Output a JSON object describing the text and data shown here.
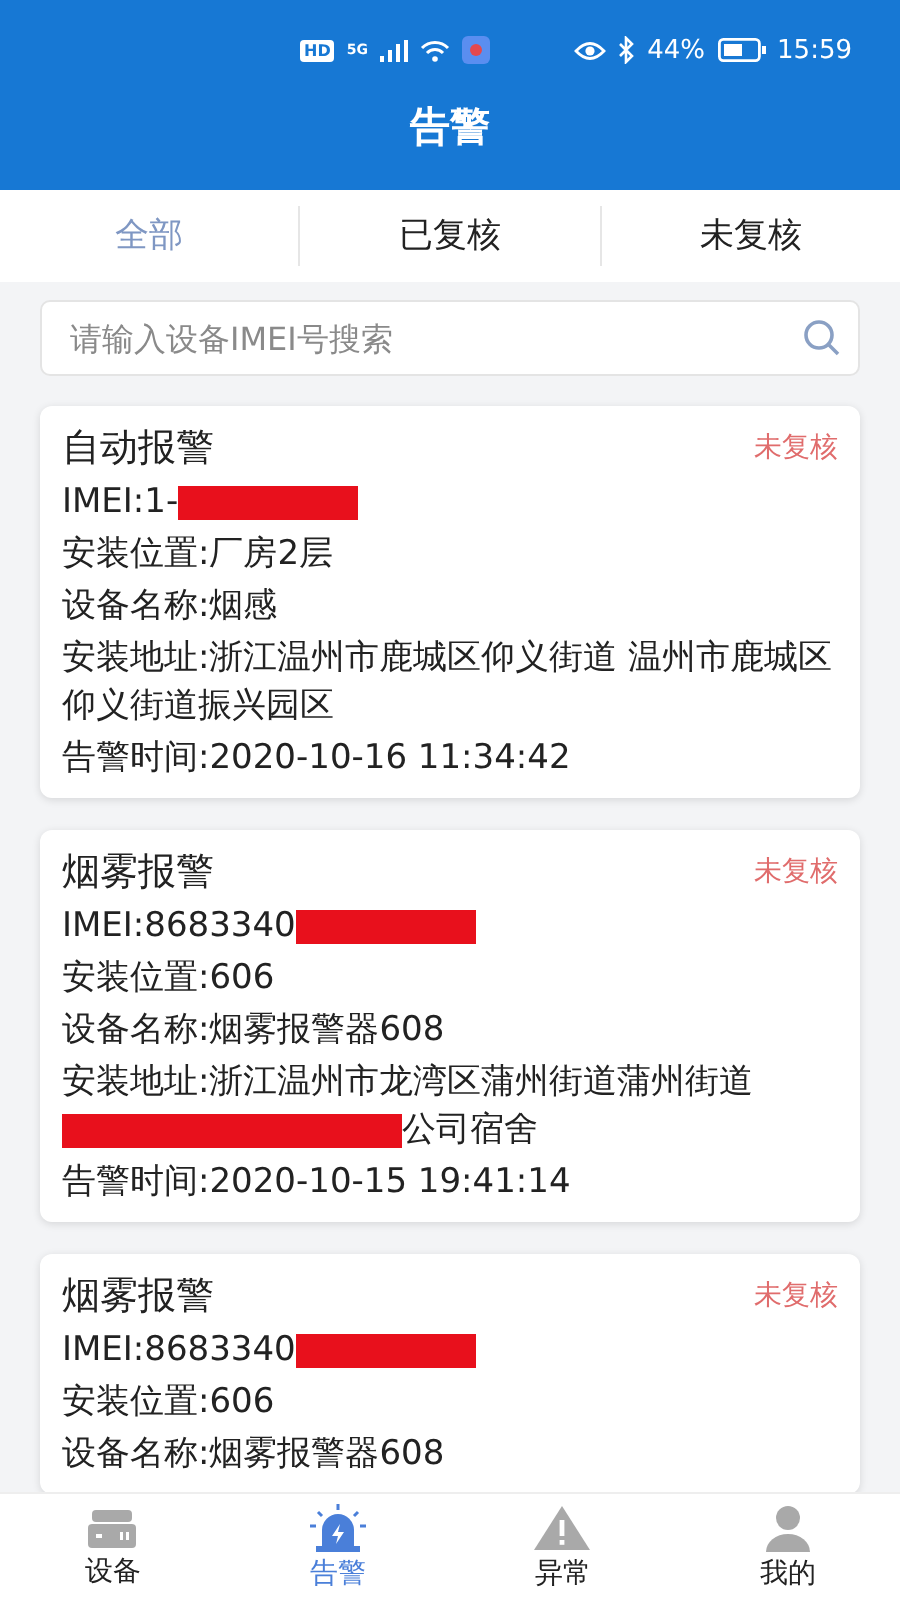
{
  "status_bar": {
    "hd": "HD",
    "network": "5G",
    "battery": "44%",
    "time": "15:59"
  },
  "header": {
    "title": "告警"
  },
  "tabs": [
    {
      "label": "全部",
      "selected": true
    },
    {
      "label": "已复核",
      "selected": false
    },
    {
      "label": "未复核",
      "selected": false
    }
  ],
  "search": {
    "placeholder": "请输入设备IMEI号搜索"
  },
  "alarms": [
    {
      "title": "自动报警",
      "status": "未复核",
      "lines": [
        {
          "text": "IMEI:1-",
          "redacted": true
        },
        {
          "text": "安装位置:厂房2层"
        },
        {
          "text": "设备名称:烟感"
        },
        {
          "text": "安装地址:浙江温州市鹿城区仰义街道 温州市鹿城区仰义街道振兴园区"
        },
        {
          "text": "告警时间:2020-10-16 11:34:42"
        }
      ]
    },
    {
      "title": "烟雾报警",
      "status": "未复核",
      "lines": [
        {
          "text": "IMEI:8683340",
          "redacted": true
        },
        {
          "text": "安装位置:606"
        },
        {
          "text": "设备名称:烟雾报警器608"
        },
        {
          "text": "安装地址:浙江温州市龙湾区蒲州街道蒲州街道",
          "redacted": true,
          "suffix": "公司宿舍"
        },
        {
          "text": "告警时间:2020-10-15 19:41:14"
        }
      ]
    },
    {
      "title": "烟雾报警",
      "status": "未复核",
      "lines": [
        {
          "text": "IMEI:8683340",
          "redacted": true
        },
        {
          "text": "安装位置:606"
        },
        {
          "text": "设备名称:烟雾报警器608"
        }
      ]
    }
  ],
  "nav": [
    {
      "label": "设备",
      "kind": "device",
      "selected": false
    },
    {
      "label": "告警",
      "kind": "alarm",
      "selected": true
    },
    {
      "label": "异常",
      "kind": "warning",
      "selected": false
    },
    {
      "label": "我的",
      "kind": "user",
      "selected": false
    }
  ]
}
